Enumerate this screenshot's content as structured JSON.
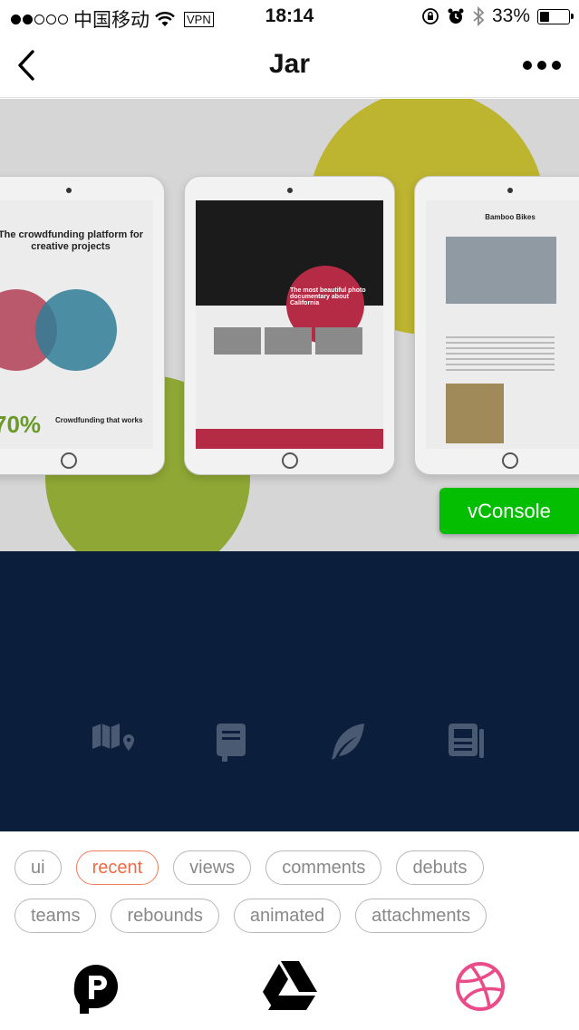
{
  "status_bar": {
    "carrier": "中国移动",
    "vpn": "VPN",
    "time": "18:14",
    "battery": "33%",
    "battery_level": 0.33
  },
  "nav": {
    "title": "Jar",
    "back_icon": "chevron-left-icon",
    "more_icon": "more-dots-icon"
  },
  "hero": {
    "slides": [
      {
        "title": "The crowdfunding platform for creative projects",
        "percent": "70%",
        "subtitle": "Crowdfunding that works"
      },
      {
        "title": "The most beautiful photo documentary about California"
      },
      {
        "title": "Bamboo Bikes"
      }
    ],
    "accent_yellow": "#bdb430",
    "accent_green": "#8fa835"
  },
  "vconsole": {
    "label": "vConsole",
    "color": "#04be02"
  },
  "dark_section": {
    "background": "#0b1e3b",
    "icons": [
      "map-marker-icon",
      "book-icon",
      "feather-icon",
      "newspaper-icon"
    ]
  },
  "tags": {
    "row1": [
      "ui",
      "recent",
      "views",
      "comments",
      "debuts"
    ],
    "row2": [
      "teams",
      "rebounds",
      "animated",
      "attachments"
    ],
    "active": "recent",
    "active_color": "#ef6a45"
  },
  "bottom_tabs": {
    "items": [
      "producthunt-icon",
      "google-drive-icon",
      "dribbble-icon"
    ],
    "dribbble_color": "#ea4c89"
  }
}
